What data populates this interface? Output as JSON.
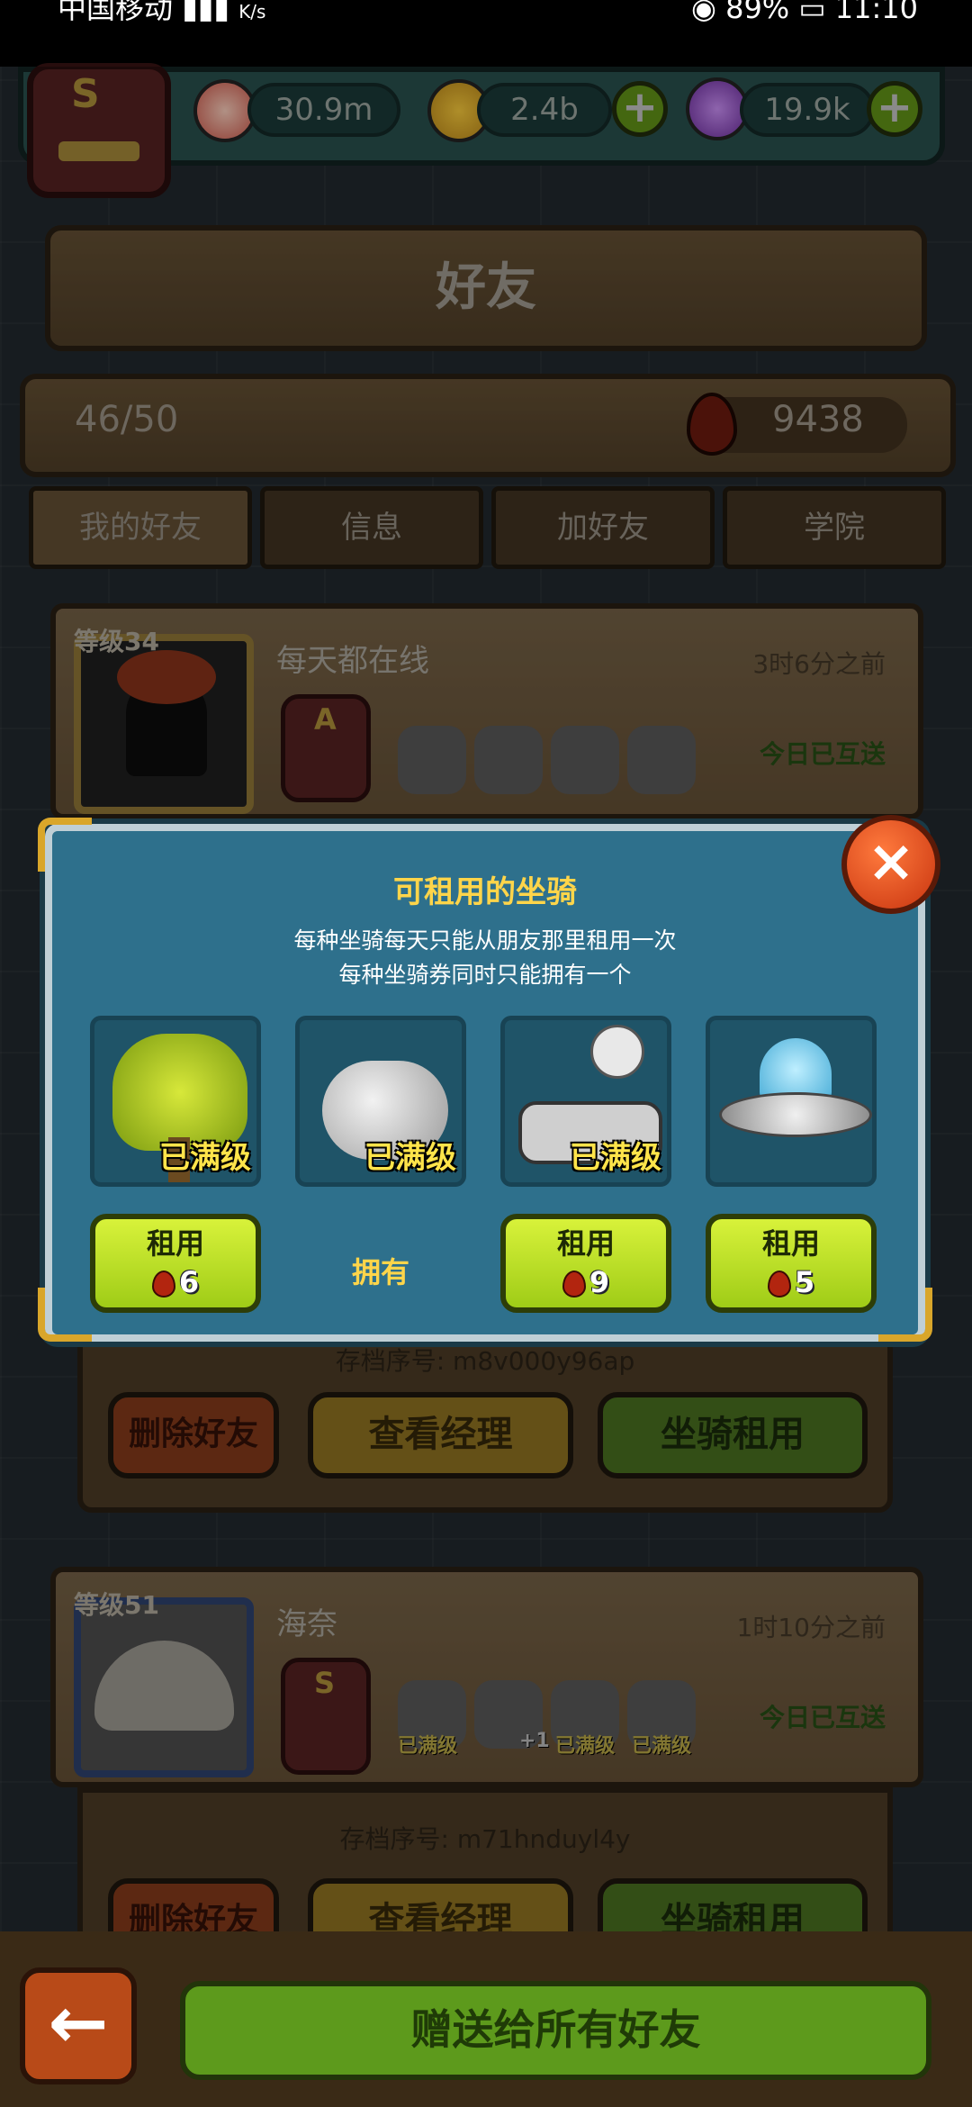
{
  "status_bar": {
    "carrier": "中国移动",
    "net_speed": "K/s",
    "battery": "89%",
    "time": "11:10"
  },
  "resources": {
    "eyes": "30.9m",
    "coins": "2.4b",
    "potion": "19.9k",
    "plus_label": "+"
  },
  "header": {
    "title": "好友",
    "friend_count": "46/50",
    "blood_count": "9438"
  },
  "tabs": [
    "我的好友",
    "信息",
    "加好友",
    "学院"
  ],
  "friends": [
    {
      "level": "等级34",
      "name": "每天都在线",
      "time": "3时6分之前",
      "sent": "今日已互送",
      "code": "存档序号: m8v000y96ap"
    },
    {
      "level": "等级51",
      "name": "海奈",
      "time": "1时10分之前",
      "sent": "今日已互送",
      "code": "存档序号: m71hnduyl4y",
      "mount_tags": [
        "已满级",
        "+1",
        "已满级",
        "已满级"
      ]
    }
  ],
  "friend_buttons": {
    "delete": "删除好友",
    "view_manager": "查看经理",
    "mount_rent": "坐骑租用"
  },
  "modal": {
    "title": "可租用的坐骑",
    "line1": "每种坐骑每天只能从朋友那里租用一次",
    "line2": "每种坐骑券同时只能拥有一个",
    "close": "×",
    "maxed_label": "已满级",
    "rent_label": "租用",
    "owned_label": "拥有",
    "mounts": [
      {
        "name": "tree-mount",
        "maxed": true,
        "cost": "6"
      },
      {
        "name": "whale-mount",
        "maxed": true,
        "owned": true
      },
      {
        "name": "tank-mount",
        "maxed": true,
        "cost": "9"
      },
      {
        "name": "ufo-mount",
        "maxed": false,
        "cost": "5"
      }
    ]
  },
  "bottom": {
    "back": "←",
    "send_all": "赠送给所有好友"
  },
  "colors": {
    "modal_bg": "#2e708c",
    "accent_yellow": "#ffd54a",
    "rent_green": "#c3e52a",
    "wood": "#8a6a3e"
  }
}
